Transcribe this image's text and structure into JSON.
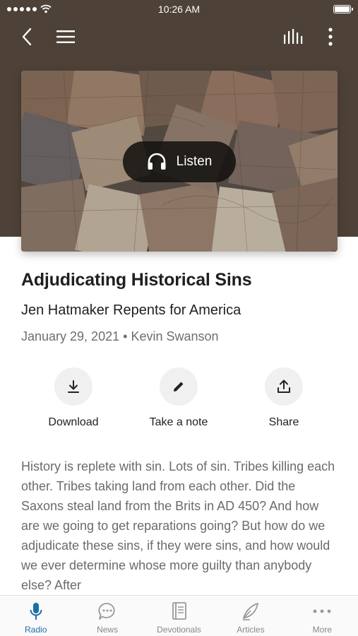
{
  "status_bar": {
    "time": "10:26 AM"
  },
  "hero": {
    "listen_label": "Listen"
  },
  "sermon": {
    "title": "Adjudicating Historical Sins",
    "subtitle": "Jen Hatmaker Repents for America",
    "date": "January 29, 2021",
    "separator": "•",
    "speaker": "Kevin Swanson"
  },
  "actions": [
    {
      "label": "Download",
      "icon": "download-icon"
    },
    {
      "label": "Take a note",
      "icon": "pencil-icon"
    },
    {
      "label": "Share",
      "icon": "share-icon"
    }
  ],
  "body_text": "History is replete with sin.  Lots of sin.  Tribes killing each other.  Tribes taking land from each other.  Did the Saxons steal land from the Brits in AD 450? And how are we going to get reparations going?  But how do we adjudicate these sins, if they were sins, and how would we ever determine whose more guilty than anybody else? After",
  "tabs": [
    {
      "label": "Radio",
      "icon": "microphone-icon",
      "active": true
    },
    {
      "label": "News",
      "icon": "chat-bubble-icon",
      "active": false
    },
    {
      "label": "Devotionals",
      "icon": "book-icon",
      "active": false
    },
    {
      "label": "Articles",
      "icon": "quill-pen-icon",
      "active": false
    },
    {
      "label": "More",
      "icon": "ellipsis-icon",
      "active": false
    }
  ],
  "colors": {
    "header_background": "#4e4238",
    "accent": "#1b6fa8",
    "muted_text": "#6b6b6b"
  }
}
